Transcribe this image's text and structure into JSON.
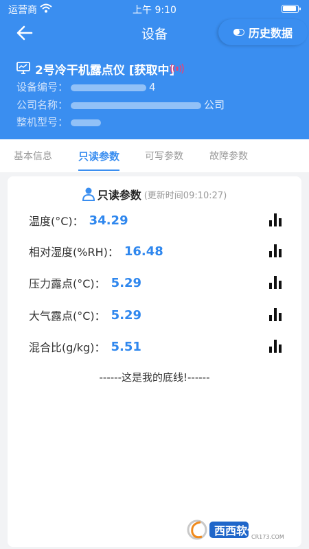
{
  "status_bar": {
    "carrier": "运营商",
    "time": "上午 9:10"
  },
  "nav": {
    "title": "设备",
    "history_label": "历史数据"
  },
  "device": {
    "title": "2号冷干机露点仪 [获取中]",
    "serial_label": "设备编号：",
    "serial_tail": "4",
    "company_label": "公司名称：",
    "company_tail": "公司",
    "model_label": "整机型号："
  },
  "tabs": [
    {
      "label": "基本信息"
    },
    {
      "label": "只读参数"
    },
    {
      "label": "可写参数"
    },
    {
      "label": "故障参数"
    }
  ],
  "card": {
    "title": "只读参数",
    "update_time": "(更新时间09:10:27)",
    "params": [
      {
        "label": "温度(°C)：",
        "value": "34.29"
      },
      {
        "label": "相对湿度(%RH)：",
        "value": "16.48"
      },
      {
        "label": "压力露点(°C)：",
        "value": "5.29"
      },
      {
        "label": "大气露点(°C)：",
        "value": "5.29"
      },
      {
        "label": "混合比(g/kg)：",
        "value": "5.51"
      }
    ],
    "bottom_line": "------这是我的底线!------"
  },
  "watermark": {
    "text": "西西软件园",
    "site": "CR173.COM"
  },
  "colors": {
    "primary": "#3a8ef0",
    "value": "#2f87ee",
    "signal": "#e0457b"
  }
}
